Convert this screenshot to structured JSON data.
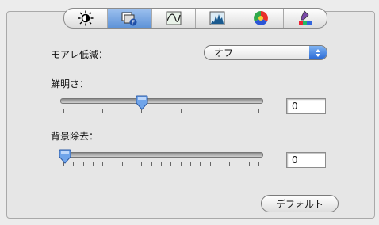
{
  "tabs": [
    {
      "name": "brightness-icon",
      "active": false
    },
    {
      "name": "moire-icon",
      "active": true
    },
    {
      "name": "curve-icon",
      "active": false
    },
    {
      "name": "histogram-icon",
      "active": false
    },
    {
      "name": "color-wheel-icon",
      "active": false
    },
    {
      "name": "color-picker-icon",
      "active": false
    }
  ],
  "moire": {
    "label": "モアレ低減：",
    "value": "オフ"
  },
  "sharpness": {
    "label": "鮮明さ：",
    "value": "0",
    "level": 0.4
  },
  "background": {
    "label": "背景除去：",
    "value": "0",
    "level": 0.0
  },
  "default_button": "デフォルト"
}
